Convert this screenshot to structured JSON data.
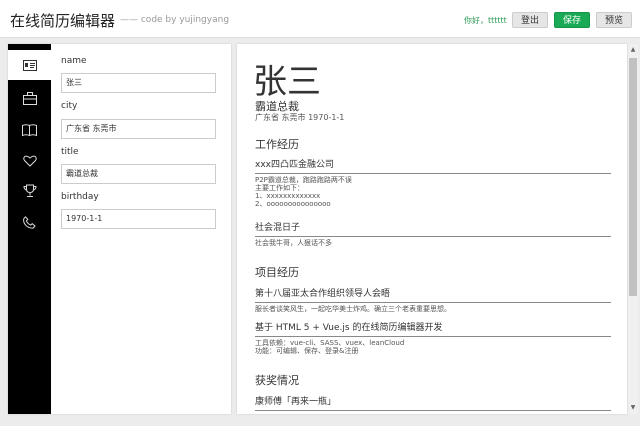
{
  "header": {
    "title": "在线简历编辑器",
    "byline": "—— code by yujingyang",
    "greeting": "你好，tttttt",
    "logout_label": "登出",
    "save_label": "保存",
    "preview_label": "预览"
  },
  "sidebar": {
    "icons": [
      "id-card-icon",
      "briefcase-icon",
      "book-icon",
      "heart-icon",
      "trophy-icon",
      "phone-icon"
    ],
    "active_index": 0
  },
  "form": {
    "fields": [
      {
        "label": "name",
        "value": "张三"
      },
      {
        "label": "city",
        "value": "广东省 东莞市"
      },
      {
        "label": "title",
        "value": "霸道总裁"
      },
      {
        "label": "birthday",
        "value": "1970-1-1"
      }
    ]
  },
  "preview": {
    "name": "张三",
    "title": "霸道总裁",
    "meta": "广东省 东莞市 1970-1-1",
    "work_heading": "工作经历",
    "work": [
      {
        "company": "xxx四凸匹金融公司",
        "lines": [
          "P2P霸道总裁，跑路跑路两不误",
          "主要工作如下：",
          "1、xxxxxxxxxxxxx",
          "2、ooooooooooooooo"
        ]
      },
      {
        "company": "社会混日子",
        "lines": [
          "社会我牛哥，人狠话不多"
        ]
      }
    ],
    "project_heading": "项目经历",
    "projects": [
      {
        "name": "第十八届亚太合作组织领导人会晤",
        "lines": [
          "服长者谈笑风生，一起吃华美士炸鸡。确立三个老表重要思想。"
        ]
      },
      {
        "name": "基于 HTML 5 + Vue.js 的在线简历编辑器开发",
        "lines": [
          "工具依赖：vue-cli、SASS、vuex、leanCloud",
          "功能：可编辑、保存、登录&注册"
        ]
      }
    ],
    "award_heading": "获奖情况",
    "awards": [
      {
        "name": "康师傅「再来一瓶」"
      }
    ]
  },
  "colors": {
    "accent": "#1aaa55",
    "greeting": "#2a9a55",
    "iconbar": "#000000"
  }
}
